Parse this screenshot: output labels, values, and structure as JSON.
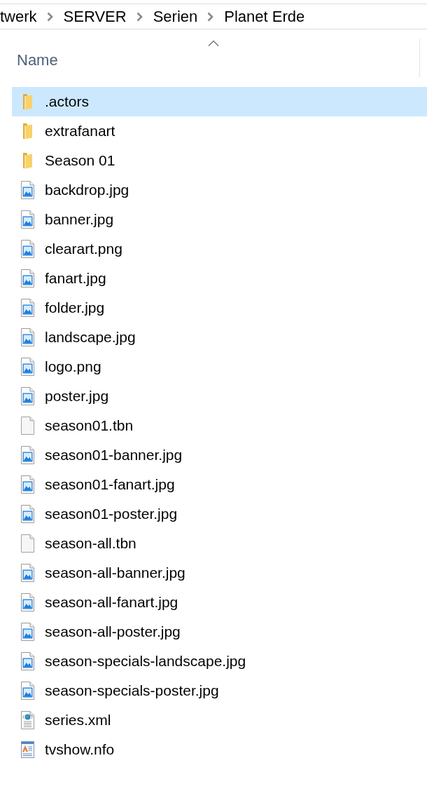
{
  "breadcrumb": [
    "twerk",
    "SERVER",
    "Serien",
    "Planet Erde"
  ],
  "column_header": {
    "label": "Name",
    "sort_ascending": true
  },
  "files": [
    {
      "name": ".actors",
      "kind": "folder",
      "selected": true
    },
    {
      "name": "extrafanart",
      "kind": "folder",
      "selected": false
    },
    {
      "name": "Season 01",
      "kind": "folder",
      "selected": false
    },
    {
      "name": "backdrop.jpg",
      "kind": "image",
      "selected": false
    },
    {
      "name": "banner.jpg",
      "kind": "image",
      "selected": false
    },
    {
      "name": "clearart.png",
      "kind": "image",
      "selected": false
    },
    {
      "name": "fanart.jpg",
      "kind": "image",
      "selected": false
    },
    {
      "name": "folder.jpg",
      "kind": "image",
      "selected": false
    },
    {
      "name": "landscape.jpg",
      "kind": "image",
      "selected": false
    },
    {
      "name": "logo.png",
      "kind": "image",
      "selected": false
    },
    {
      "name": "poster.jpg",
      "kind": "image",
      "selected": false
    },
    {
      "name": "season01.tbn",
      "kind": "blank",
      "selected": false
    },
    {
      "name": "season01-banner.jpg",
      "kind": "image",
      "selected": false
    },
    {
      "name": "season01-fanart.jpg",
      "kind": "image",
      "selected": false
    },
    {
      "name": "season01-poster.jpg",
      "kind": "image",
      "selected": false
    },
    {
      "name": "season-all.tbn",
      "kind": "blank",
      "selected": false
    },
    {
      "name": "season-all-banner.jpg",
      "kind": "image",
      "selected": false
    },
    {
      "name": "season-all-fanart.jpg",
      "kind": "image",
      "selected": false
    },
    {
      "name": "season-all-poster.jpg",
      "kind": "image",
      "selected": false
    },
    {
      "name": "season-specials-landscape.jpg",
      "kind": "image",
      "selected": false
    },
    {
      "name": "season-specials-poster.jpg",
      "kind": "image",
      "selected": false
    },
    {
      "name": "series.xml",
      "kind": "xml",
      "selected": false
    },
    {
      "name": "tvshow.nfo",
      "kind": "nfo",
      "selected": false
    }
  ]
}
